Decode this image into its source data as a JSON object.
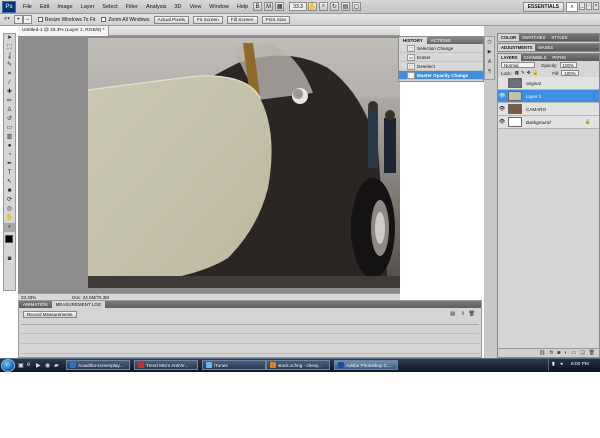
{
  "menubar": {
    "logo": "Ps",
    "items": [
      "File",
      "Edit",
      "Image",
      "Layer",
      "Select",
      "Filter",
      "Analysis",
      "3D",
      "View",
      "Window",
      "Help"
    ],
    "zoom": "33.3",
    "workspace": "ESSENTIALS"
  },
  "options_bar": {
    "resize_windows": "Resize Windows To Fit",
    "zoom_all": "Zoom All Windows",
    "actual_pixels": "Actual Pixels",
    "fit_screen": "Fit Screen",
    "fill_screen": "Fill Screen",
    "print_size": "Print Size"
  },
  "document": {
    "tab_title": "Untitled-1 @ 33.3% (Layer 1, RGB/8) *",
    "zoom": "33.33%",
    "doc_size": "Doc: 24.0M/75.3M"
  },
  "history": {
    "tabs": [
      "HISTORY",
      "ACTIONS"
    ],
    "items": [
      {
        "label": "Selection Change",
        "icon": "marquee-icon",
        "selected": false
      },
      {
        "label": "Eraser",
        "icon": "eraser-icon",
        "selected": false
      },
      {
        "label": "Deselect",
        "icon": "deselect-icon",
        "selected": false
      },
      {
        "label": "Master Opacity Change",
        "icon": "layer-icon",
        "selected": true
      }
    ]
  },
  "panels": {
    "color_tabs": [
      "COLOR",
      "SWATCHES",
      "STYLES"
    ],
    "adjust_tabs": [
      "ADJUSTMENTS",
      "MASKS"
    ],
    "layers_tabs": [
      "LAYERS",
      "CHANNELS",
      "PATHS"
    ]
  },
  "layers": {
    "blend_mode": "Normal",
    "opacity_label": "Opacity:",
    "opacity_value": "100%",
    "lock_label": "Lock:",
    "fill_label": "Fill:",
    "fill_value": "100%",
    "items": [
      {
        "name": "original",
        "visible": false,
        "selected": false,
        "thumb": "#6b7178",
        "locked": false
      },
      {
        "name": "Layer 1",
        "visible": true,
        "selected": true,
        "thumb": "#c4c1aa",
        "locked": false
      },
      {
        "name": "CAMARO",
        "visible": true,
        "selected": false,
        "thumb": "#7a5a40",
        "locked": false
      },
      {
        "name": "Background",
        "visible": true,
        "selected": false,
        "thumb": "#ffffff",
        "locked": true
      }
    ]
  },
  "bottom_panel": {
    "tabs": [
      "ANIMATION",
      "MEASUREMENT LOG"
    ],
    "record_button": "Record Measurements"
  },
  "taskbar": {
    "buttons": [
      {
        "label": "Acaultha-screenplay...",
        "color": "#2f6fc4",
        "active": false
      },
      {
        "label": "Trend Micro AntiVir...",
        "color": "#c4302f",
        "active": false
      },
      {
        "label": "iTunes",
        "color": "#6fb3e8",
        "active": false
      },
      {
        "label": "stock.xchng - chevy...",
        "color": "#d9822b",
        "active": false
      },
      {
        "label": "Adobe Photoshop C...",
        "color": "#1a4fa0",
        "active": true
      }
    ],
    "clock": "6:00 PM"
  },
  "colors": {
    "selection_blue": "#3d8fe2",
    "workspace_gray": "#8c8c8c"
  }
}
